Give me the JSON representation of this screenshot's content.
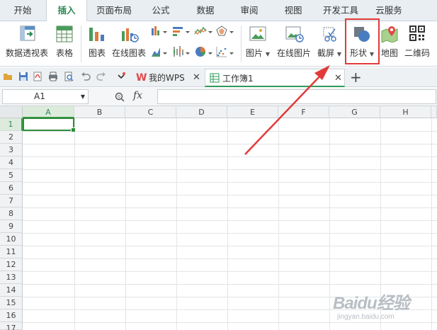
{
  "menu": {
    "tabs": [
      "开始",
      "插入",
      "页面布局",
      "公式",
      "数据",
      "审阅",
      "视图",
      "开发工具",
      "云服务"
    ],
    "active_index": 1
  },
  "ribbon": {
    "pivot_table": "数据透视表",
    "table": "表格",
    "chart": "图表",
    "online_chart": "在线图表",
    "picture": "图片",
    "online_picture": "在线图片",
    "screenshot": "截屏",
    "shape": "形状",
    "map": "地图",
    "qrcode": "二维码"
  },
  "doctabs": {
    "my_wps": "我的WPS",
    "workbook": "工作簿1",
    "wps_logo_text": "W",
    "add": "+"
  },
  "formula_bar": {
    "cell_ref": "A1",
    "fx_label": "fx",
    "value": ""
  },
  "grid": {
    "columns": [
      "A",
      "B",
      "C",
      "D",
      "E",
      "F",
      "G",
      "H"
    ],
    "rows": [
      "1",
      "2",
      "3",
      "4",
      "5",
      "6",
      "7",
      "8",
      "9",
      "10",
      "11",
      "12",
      "13",
      "14",
      "15",
      "16",
      "17"
    ],
    "selected": "A1"
  },
  "watermark": {
    "logo": "Baidu经验",
    "url": "jingyan.baidu.com"
  },
  "colors": {
    "accent_green": "#2e8b57",
    "highlight_red": "#e23a3a"
  }
}
